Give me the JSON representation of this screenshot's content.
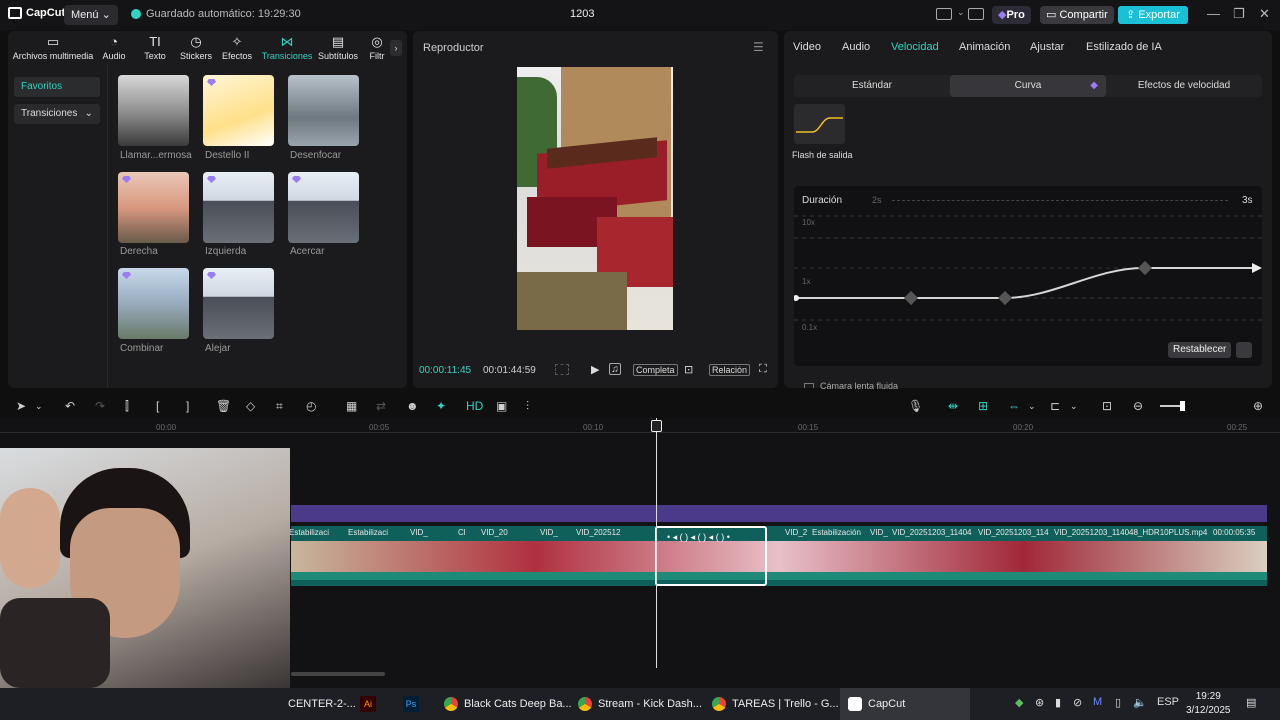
{
  "titlebar": {
    "logo": "CapCut",
    "menu": "Menú",
    "autosave": "Guardado automático: 19:29:30",
    "project": "1203",
    "pro": "Pro",
    "share": "Compartir",
    "export": "Exportar"
  },
  "media_tabs": [
    {
      "label": "Archivos multimedia",
      "icon": "media-icon"
    },
    {
      "label": "Audio",
      "icon": "audio-icon"
    },
    {
      "label": "Texto",
      "icon": "text-icon"
    },
    {
      "label": "Stickers",
      "icon": "sticker-icon"
    },
    {
      "label": "Efectos",
      "icon": "effects-icon"
    },
    {
      "label": "Transiciones",
      "icon": "transition-icon"
    },
    {
      "label": "Subtítulos",
      "icon": "subtitles-icon"
    },
    {
      "label": "Filtr",
      "icon": "filter-icon"
    }
  ],
  "side": {
    "favorites": "Favoritos",
    "transitions": "Transiciones"
  },
  "thumbs": [
    {
      "label": "Llamar...ermosa"
    },
    {
      "label": "Destello II"
    },
    {
      "label": "Desenfocar"
    },
    {
      "label": "Derecha"
    },
    {
      "label": "Izquierda"
    },
    {
      "label": "Acercar"
    },
    {
      "label": "Combinar"
    },
    {
      "label": "Alejar"
    }
  ],
  "player": {
    "title": "Reproductor",
    "current": "00:00:11:45",
    "total": "00:01:44:59",
    "full": "Completa",
    "ratio": "Relación"
  },
  "right": {
    "tabs": [
      "Video",
      "Audio",
      "Velocidad",
      "Animación",
      "Ajustar",
      "Estilizado de IA"
    ],
    "seg": [
      "Estándar",
      "Curva",
      "Efectos de velocidad"
    ],
    "curve_name": "Flash de salida",
    "duration": "Duración",
    "dur_min": "2s",
    "dur_max": "3s",
    "axis_top": "10x",
    "axis_mid": "1x",
    "axis_bot": "0.1x",
    "reset": "Restablecer",
    "slow": "Cámara lenta fluida"
  },
  "ruler": [
    "00:00",
    "00:05",
    "00:10",
    "00:15",
    "00:20",
    "00:25"
  ],
  "clips": [
    "Estabilizaci",
    "Estabilizaci",
    "VID_",
    "Cl",
    "VID_20",
    "VID_",
    "VID_202512",
    "VID_2",
    "Estabilización",
    "VID_",
    "VID_20251203_11404",
    "VID_20251203_114",
    "VID_20251203_114048_HDR10PLUS.mp4",
    "00:00:05:35"
  ],
  "taskbar": [
    {
      "label": "CENTER-2-..."
    },
    {
      "label": "Black Cats Deep Ba..."
    },
    {
      "label": "Stream - Kick Dash..."
    },
    {
      "label": "TAREAS | Trello - G..."
    },
    {
      "label": "CapCut"
    }
  ],
  "tray": {
    "lang": "ESP",
    "time": "19:29",
    "date": "3/12/2025"
  },
  "colors": {
    "accent": "#2fd3c0",
    "audio_track": "#4b3a8a",
    "video_track": "#0f5f5a",
    "export": "#19c0d6"
  }
}
